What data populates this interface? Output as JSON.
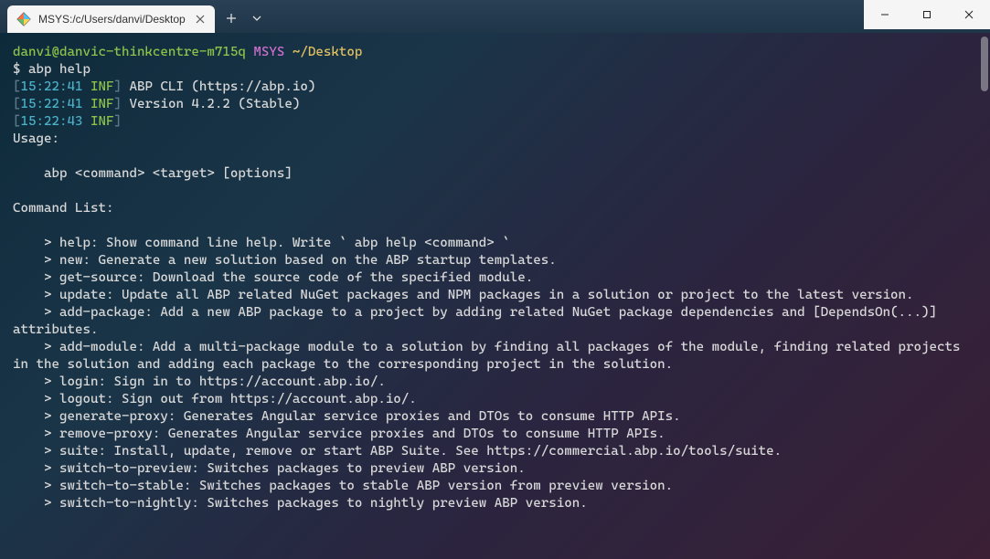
{
  "titlebar": {
    "tab": {
      "title": "MSYS:/c/Users/danvi/Desktop",
      "icon": "msys-diamond-icon"
    }
  },
  "prompt": {
    "user_host": "danvi@danvic-thinkcentre-m715q",
    "shell": "MSYS",
    "cwd": "~/Desktop",
    "sym": "$",
    "command": "abp help"
  },
  "log": {
    "l1_time": "15:22:41",
    "l1_level": "INF",
    "l1_text": " ABP CLI (https://abp.io)",
    "l2_time": "15:22:41",
    "l2_level": "INF",
    "l2_text": " Version 4.2.2 (Stable)",
    "l3_time": "15:22:43",
    "l3_level": "INF",
    "l3_text": ""
  },
  "body": {
    "usage_hdr": "Usage:",
    "usage_line": "    abp <command> <target> [options]",
    "cmdlist_hdr": "Command List:",
    "cmd_help": "    > help: Show command line help. Write ` abp help <command> `",
    "cmd_new": "    > new: Generate a new solution based on the ABP startup templates.",
    "cmd_getsrc": "    > get-source: Download the source code of the specified module.",
    "cmd_update": "    > update: Update all ABP related NuGet packages and NPM packages in a solution or project to the latest version.",
    "cmd_addpkg": "    > add-package: Add a new ABP package to a project by adding related NuGet package dependencies and [DependsOn(...)] attributes.",
    "cmd_addmod": "    > add-module: Add a multi-package module to a solution by finding all packages of the module, finding related projects in the solution and adding each package to the corresponding project in the solution.",
    "cmd_login": "    > login: Sign in to https://account.abp.io/.",
    "cmd_logout": "    > logout: Sign out from https://account.abp.io/.",
    "cmd_genprx": "    > generate-proxy: Generates Angular service proxies and DTOs to consume HTTP APIs.",
    "cmd_remprx": "    > remove-proxy: Generates Angular service proxies and DTOs to consume HTTP APIs.",
    "cmd_suite": "    > suite: Install, update, remove or start ABP Suite. See https://commercial.abp.io/tools/suite.",
    "cmd_swprev": "    > switch-to-preview: Switches packages to preview ABP version.",
    "cmd_swstab": "    > switch-to-stable: Switches packages to stable ABP version from preview version.",
    "cmd_swnight": "    > switch-to-nightly: Switches packages to nightly preview ABP version."
  }
}
